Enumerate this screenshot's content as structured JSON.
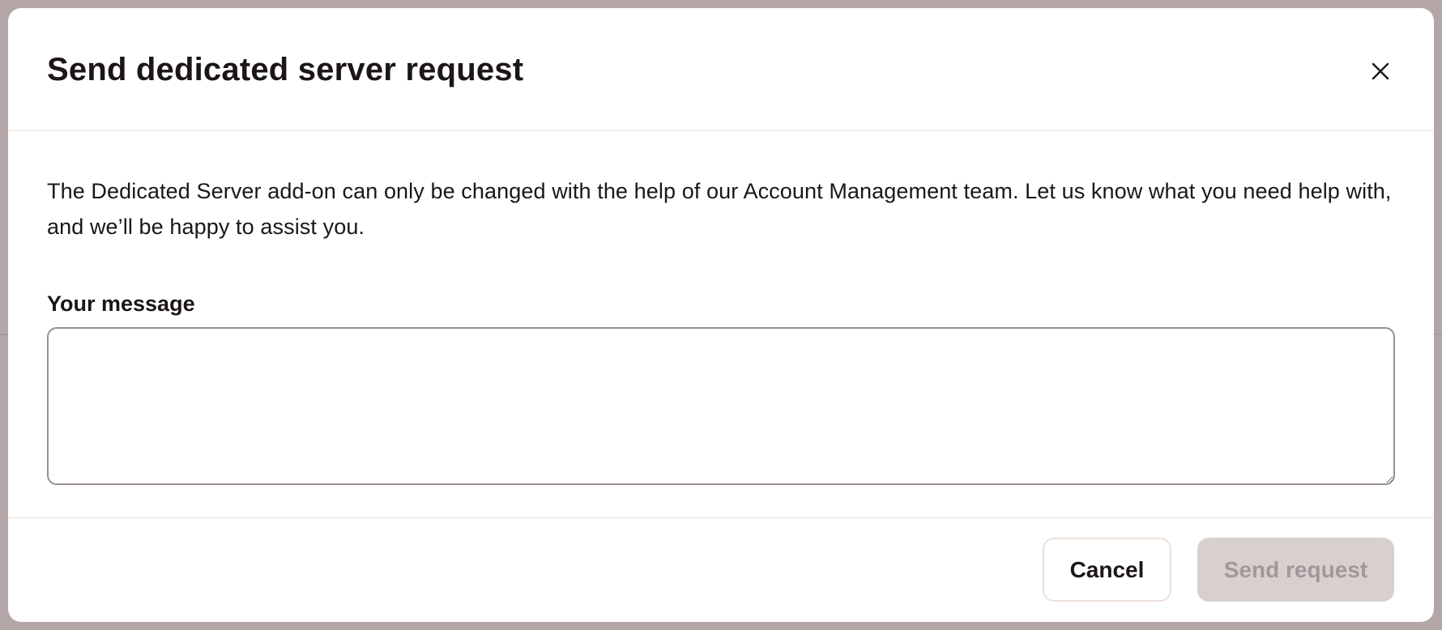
{
  "modal": {
    "title": "Send dedicated server request",
    "close_icon": "close-icon",
    "description": "The Dedicated Server add-on can only be changed with the help of our Account Management team. Let us know what you need help with, and we’ll be happy to assist you.",
    "message_label": "Your message",
    "message_value": "",
    "message_placeholder": "",
    "cancel_label": "Cancel",
    "send_label": "Send request",
    "send_disabled": true
  },
  "colors": {
    "backdrop": "#b4a6a6",
    "surface": "#ffffff",
    "divider": "#ede0da",
    "text": "#1c1616",
    "disabled_bg": "#d8cfcf",
    "disabled_text": "#a4979a",
    "input_border": "#9a8f8c"
  }
}
